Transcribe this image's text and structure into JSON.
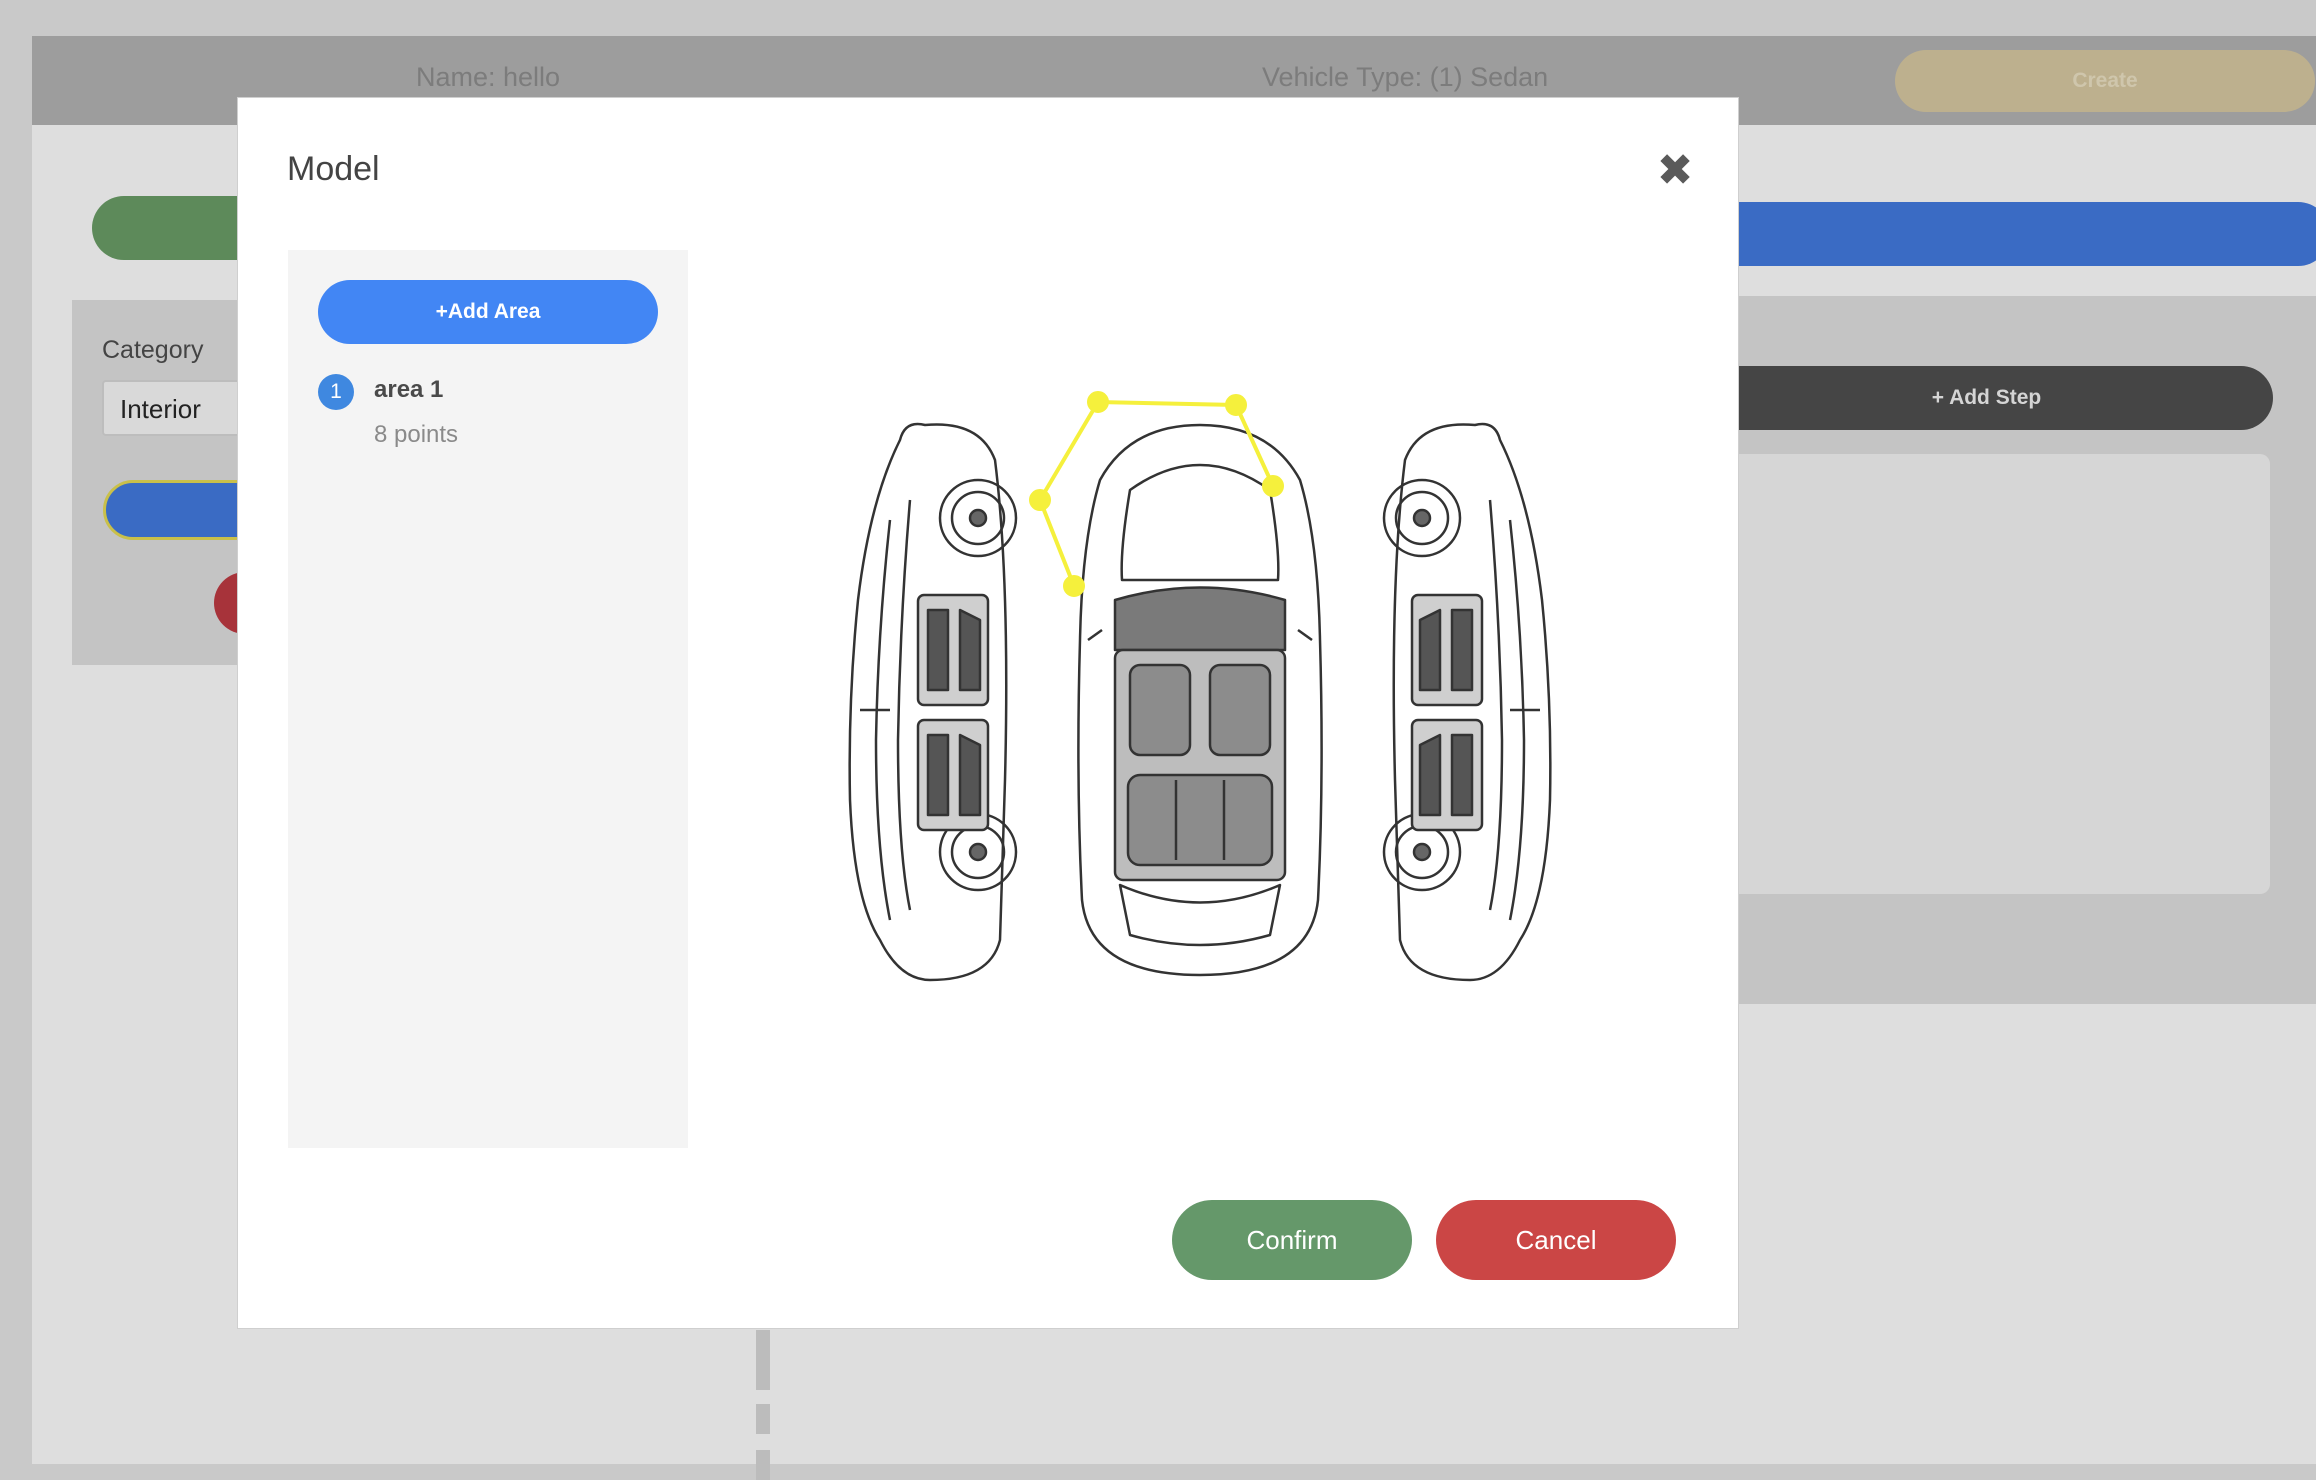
{
  "header": {
    "name_text": "Name: hello",
    "vehicle_type_text": "Vehicle Type: (1) Sedan",
    "create_label": "Create"
  },
  "background": {
    "category_label": "Category",
    "category_value": "Interior",
    "add_step_label": "+ Add Step"
  },
  "modal": {
    "title": "Model",
    "close_icon": "close-icon",
    "add_area_label": "+Add Area",
    "areas": [
      {
        "index": "1",
        "name": "area 1",
        "points_text": "8 points"
      }
    ],
    "confirm_label": "Confirm",
    "cancel_label": "Cancel"
  },
  "colors": {
    "overlay": "#c9c9c9",
    "accent_blue": "#4286f4",
    "confirm_green": "#65986a",
    "cancel_red": "#cb4645",
    "polygon_yellow": "#f5f03c"
  }
}
